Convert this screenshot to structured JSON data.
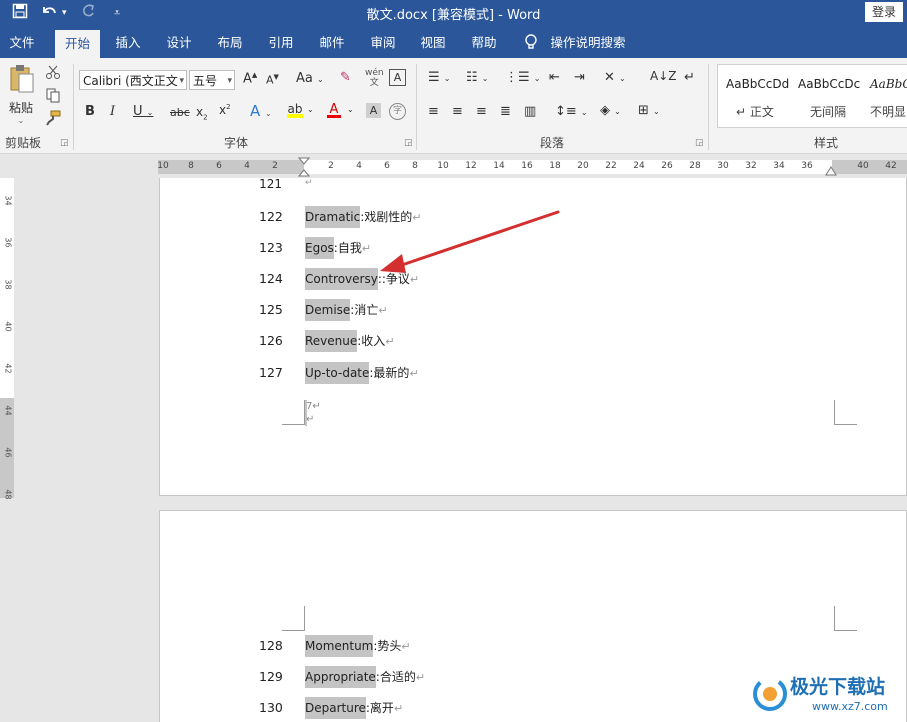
{
  "titlebar": {
    "title": "散文.docx [兼容模式]  -  Word",
    "login": "登录",
    "save_icon": "save-icon",
    "undo_icon": "undo-icon",
    "redo_icon": "redo-icon"
  },
  "tabs": [
    "文件",
    "开始",
    "插入",
    "设计",
    "布局",
    "引用",
    "邮件",
    "审阅",
    "视图",
    "帮助",
    "操作说明搜索"
  ],
  "active_tab": "开始",
  "ribbon": {
    "clipboard": {
      "label": "剪贴板",
      "paste": "粘贴"
    },
    "font": {
      "label": "字体",
      "font_name": "Calibri (西文正文",
      "font_size": "五号"
    },
    "paragraph": {
      "label": "段落"
    },
    "styles": {
      "label": "样式",
      "items": [
        {
          "sample": "AaBbCcDd",
          "name": "↵ 正文"
        },
        {
          "sample": "AaBbCcDc",
          "name": "无间隔"
        },
        {
          "sample": "AaBbC",
          "name": "不明显"
        }
      ]
    }
  },
  "ruler": {
    "h_numbers": [
      "10",
      "8",
      "6",
      "4",
      "2",
      "2",
      "4",
      "6",
      "8",
      "10",
      "12",
      "14",
      "16",
      "18",
      "20",
      "22",
      "24",
      "26",
      "28",
      "30",
      "32",
      "34",
      "36",
      "40",
      "42"
    ],
    "v_numbers": [
      "34",
      "36",
      "38",
      "40",
      "42",
      "44",
      "46",
      "48"
    ]
  },
  "page1": {
    "top_partial_number": "121",
    "lines": [
      {
        "num": "122",
        "term": "Dramatic",
        "meaning": ":戏剧性的↵"
      },
      {
        "num": "123",
        "term": "Egos",
        "meaning": ":自我↵"
      },
      {
        "num": "124",
        "term": "Controversy",
        "meaning": "::争议↵"
      },
      {
        "num": "125",
        "term": "Demise",
        "meaning": ":消亡↵"
      },
      {
        "num": "126",
        "term": "Revenue",
        "meaning": ":收入↵"
      },
      {
        "num": "127",
        "term": "Up-to-date",
        "meaning": ":最新的↵"
      }
    ],
    "footer_page_number": "7↵",
    "footer_para_mark": "↵"
  },
  "page2": {
    "lines": [
      {
        "num": "128",
        "term": "Momentum",
        "meaning": ":势头↵"
      },
      {
        "num": "129",
        "term": "Appropriate",
        "meaning": ":合适的↵"
      },
      {
        "num": "130",
        "term": "Departure",
        "meaning": ":离开↵"
      }
    ]
  },
  "watermark": {
    "text": "极光下载站",
    "url": "www.xz7.com"
  },
  "colors": {
    "accent": "#2b579a",
    "arrow": "#d32f2f"
  }
}
